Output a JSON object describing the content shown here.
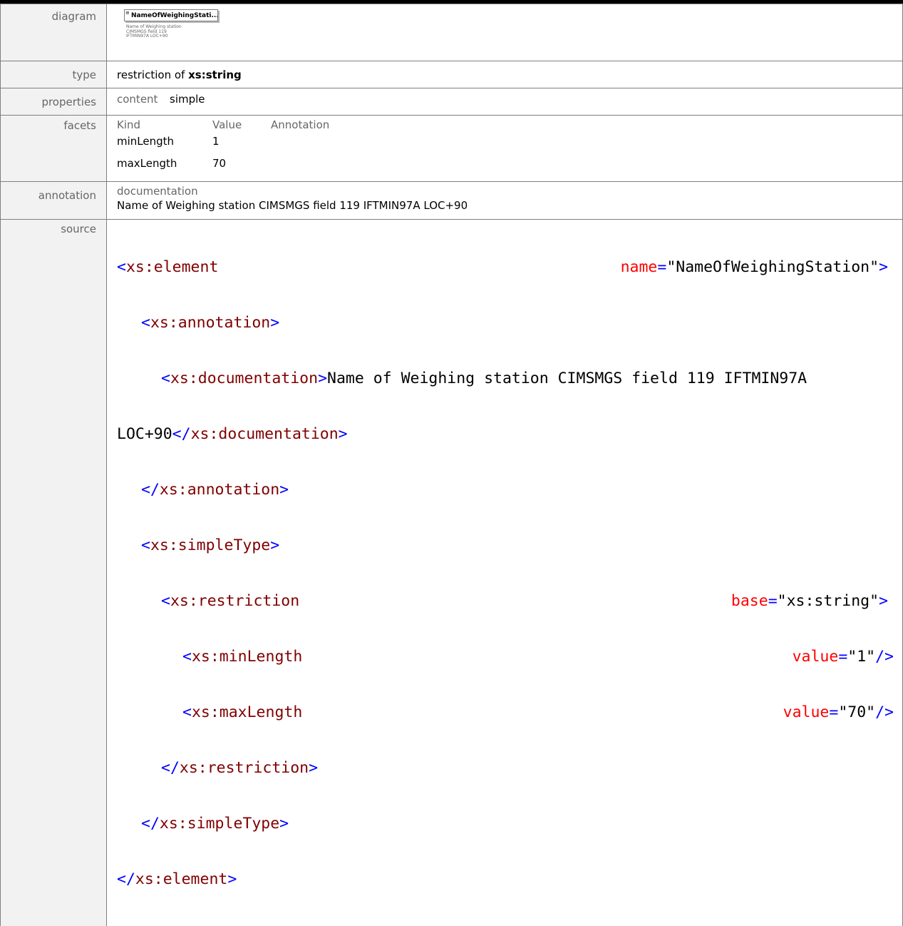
{
  "labels": {
    "diagram": "diagram",
    "type": "type",
    "properties": "properties",
    "facets": "facets",
    "annotation": "annotation",
    "source": "source"
  },
  "diagram": {
    "box_title": "NameOfWeighingStati...",
    "doc_lines": [
      "Name of Weighing station",
      "CIMSMGS field 119",
      "IFTMIN97A LOC+90"
    ]
  },
  "type": {
    "prefix": "restriction of",
    "base": "xs:string"
  },
  "properties": {
    "key": "content",
    "value": "simple"
  },
  "facets": {
    "headers": [
      "Kind",
      "Value",
      "Annotation"
    ],
    "rows": [
      {
        "kind": "minLength",
        "value": "1"
      },
      {
        "kind": "maxLength",
        "value": "70"
      }
    ]
  },
  "annotation": {
    "head": "documentation",
    "text": "Name of Weighing station CIMSMGS field 119 IFTMIN97A LOC+90"
  },
  "source": {
    "l1_tag": "xs:element",
    "l1_attr": "name",
    "l1_val": "\"NameOfWeighingStation\"",
    "l2_tag": "xs:annotation",
    "l3_tag": "xs:documentation",
    "l3_text": "Name of Weighing station CIMSMGS field 119 IFTMIN97A",
    "l4_text": "LOC+90",
    "l4_close": "xs:documentation",
    "l5_close": "xs:annotation",
    "l6_tag": "xs:simpleType",
    "l7_tag": "xs:restriction",
    "l7_attr": "base",
    "l7_val": "\"xs:string\"",
    "l8_tag": "xs:minLength",
    "l8_attr": "value",
    "l8_val": "\"1\"",
    "l9_tag": "xs:maxLength",
    "l9_attr": "value",
    "l9_val": "\"70\"",
    "l10_close": "xs:restriction",
    "l11_close": "xs:simpleType",
    "l12_close": "xs:element"
  }
}
